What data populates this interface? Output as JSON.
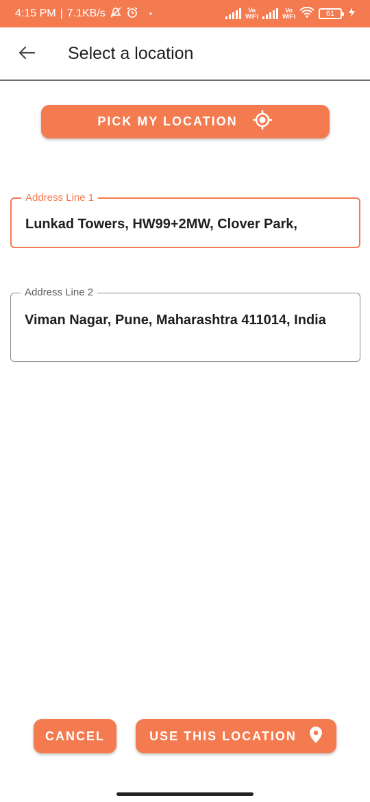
{
  "status_bar": {
    "time": "4:15 PM",
    "network_speed": "7.1KB/s",
    "vowifi_1": "Vo\nWiFi",
    "vowifi_2": "Vo\nWiFi",
    "battery": "61",
    "icons": [
      "mute-icon",
      "alarm-icon",
      "signal-icon",
      "wifi-icon",
      "battery-icon",
      "charging-icon"
    ]
  },
  "app_bar": {
    "title": "Select a location",
    "back_icon": "arrow-left-icon"
  },
  "pick_location_button": {
    "label": "PICK MY LOCATION",
    "icon": "gps-target-icon"
  },
  "address_line_1": {
    "label": "Address Line 1",
    "value": "Lunkad Towers, HW99+2MW, Clover Park,"
  },
  "address_line_2": {
    "label": "Address Line 2",
    "value": "Viman Nagar, Pune, Maharashtra 411014, India"
  },
  "actions": {
    "cancel_label": "CANCEL",
    "use_location_label": "USE THIS LOCATION",
    "use_location_icon": "map-pin-icon"
  },
  "colors": {
    "accent": "#f47a50",
    "text": "#1f1f1f",
    "muted_label": "#5b5b5b"
  }
}
